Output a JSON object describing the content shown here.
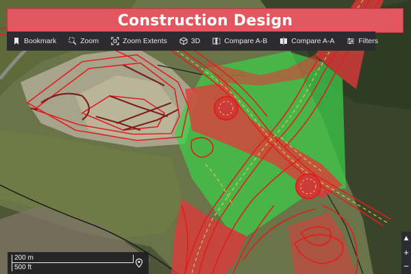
{
  "title": "Construction Design",
  "toolbar": {
    "items": [
      {
        "label": "Bookmark",
        "icon": "bookmark-icon"
      },
      {
        "label": "Zoom",
        "icon": "zoom-icon"
      },
      {
        "label": "Zoom Extents",
        "icon": "zoom-extents-icon"
      },
      {
        "label": "3D",
        "icon": "cube-icon"
      },
      {
        "label": "Compare A-B",
        "icon": "compare-ab-icon"
      },
      {
        "label": "Compare A-A",
        "icon": "compare-aa-icon"
      },
      {
        "label": "Filters",
        "icon": "filters-icon"
      }
    ]
  },
  "scale": {
    "metric": "200 m",
    "imperial": "500 ft"
  },
  "zoom_controls": {
    "up": "▴",
    "plus": "+",
    "minus": "−"
  },
  "colors": {
    "title_bg": "#e2575f",
    "toolbar_bg": "#2b2b30",
    "cut_overlay": "#e03a3a",
    "fill_overlay": "#3ccf4a",
    "design_line": "#e11d1d",
    "existing_line": "#7a1f1a"
  }
}
